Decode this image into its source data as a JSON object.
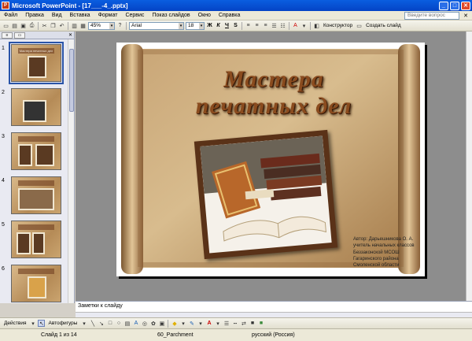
{
  "window": {
    "title": "Microsoft PowerPoint - [17___-4_.pptx]",
    "min": "_",
    "max": "□",
    "close": "✕"
  },
  "menu": {
    "items": [
      "Файл",
      "Правка",
      "Вид",
      "Вставка",
      "Формат",
      "Сервис",
      "Показ слайдов",
      "Окно",
      "Справка"
    ],
    "question_placeholder": "Введите вопрос",
    "close_doc": "✕"
  },
  "toolbar": {
    "zoom": "45%",
    "font": "Arial",
    "size": "18",
    "bold": "Ж",
    "italic": "К",
    "underline": "Ч",
    "shadow": "S",
    "designer": "Конструктор",
    "new_slide": "Создать слайд"
  },
  "slides": [
    {
      "num": "1",
      "caption": "Мастера печатных дел"
    },
    {
      "num": "2",
      "caption": ""
    },
    {
      "num": "3",
      "caption": ""
    },
    {
      "num": "4",
      "caption": ""
    },
    {
      "num": "5",
      "caption": ""
    },
    {
      "num": "6",
      "caption": ""
    }
  ],
  "slide": {
    "title_line1": "Мастера",
    "title_line2": "печатных дел",
    "author": [
      "Автор: Дарьешникова О. А.",
      "учитель начальных классов",
      "Беззаконской МСОШ",
      "Гагаринского района",
      "Смоленской области"
    ]
  },
  "notes": {
    "placeholder": "Заметки к слайду"
  },
  "drawbar": {
    "actions": "Действия",
    "autoshapes": "Автофигуры"
  },
  "status": {
    "slide_counter": "Слайд 1 из 14",
    "design": "60_Parchment",
    "language": "русский (Россия)"
  }
}
